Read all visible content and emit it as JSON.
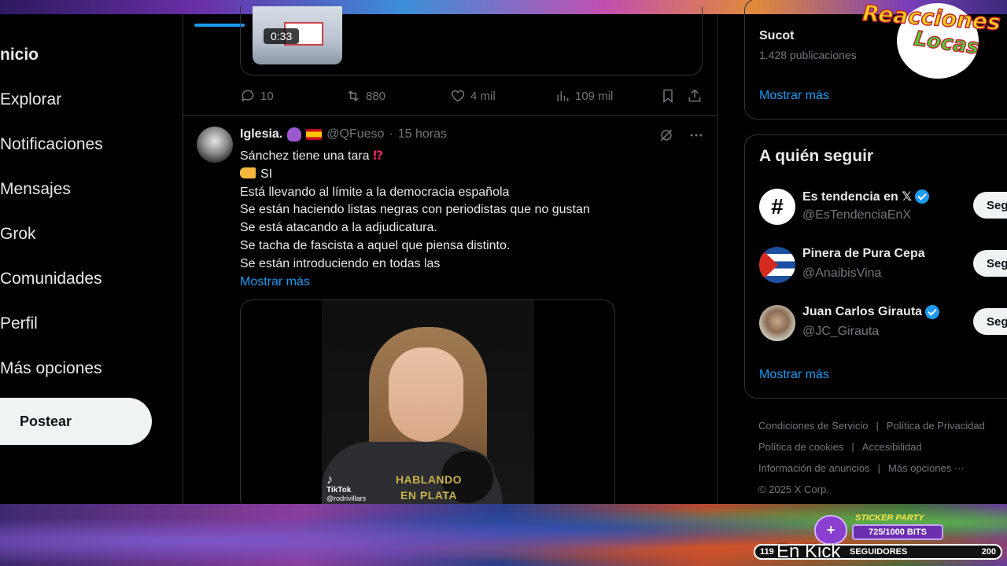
{
  "nav": {
    "items": [
      {
        "label": "nicio"
      },
      {
        "label": "Explorar"
      },
      {
        "label": "Notificaciones"
      },
      {
        "label": "Mensajes"
      },
      {
        "label": "Grok"
      },
      {
        "label": "Comunidades"
      },
      {
        "label": "Perfil"
      },
      {
        "label": "Más opciones"
      }
    ],
    "post_button": "Postear"
  },
  "previous_tweet": {
    "video_duration": "0:33",
    "actions": {
      "replies": "10",
      "reposts": "880",
      "likes": "4 mil",
      "views": "109 mil"
    }
  },
  "tweet": {
    "name": "Iglesia.",
    "handle": "@QFueso",
    "separator": "·",
    "time": "15 horas",
    "lines": [
      "Sánchez tiene una tara",
      "SI",
      "Está llevando al límite a la democracia española",
      "Se están haciendo listas negras con periodistas que no gustan",
      "Se está atacando a la adjudicatura.",
      "Se tacha de fascista a aquel que piensa distinto.",
      "Se están introduciendo en todas las"
    ],
    "interrobang": "⁉",
    "show_more": "Mostrar más",
    "video": {
      "watermark": "TikTok",
      "watermark_handle": "@rodrivillars",
      "caption": "HABLANDO EN PLATA"
    }
  },
  "sidebar": {
    "trend": {
      "name": "Sucot",
      "count": "1.428 publicaciones",
      "show_more": "Mostrar más"
    },
    "who_to_follow": {
      "title": "A quién seguir",
      "accounts": [
        {
          "name": "Es tendencia en 𝕏",
          "handle": "@EsTendenciaEnX",
          "verified": true,
          "button": "Seguir"
        },
        {
          "name": "Pinera de Pura Cepa",
          "handle": "@AnaibisVina",
          "verified": false,
          "button": "Seguir"
        },
        {
          "name": "Juan Carlos Girauta",
          "handle": "@JC_Girauta",
          "verified": true,
          "button": "Seguir"
        }
      ],
      "show_more": "Mostrar más"
    },
    "footer": {
      "terms": "Condiciones de Servicio",
      "privacy": "Política de Privacidad",
      "cookies": "Política de cookies",
      "accessibility": "Accesibilidad",
      "ads_info": "Información de anuncios",
      "more": "Más opciones ···",
      "copyright": "© 2025 X Corp.",
      "separator": "|"
    }
  },
  "overlay": {
    "logo_line1": "Reacciones",
    "logo_line2": "Locas",
    "sticker_title": "STICKER PARTY",
    "bits": "725/1000 BITS",
    "heart_symbol": "+",
    "followers_left": "119",
    "followers_label": "SEGUIDORES",
    "followers_right": "200",
    "platform": "En Kick"
  },
  "colors": {
    "accent": "#1d9bf0",
    "text": "#e7e9ea",
    "muted": "#71767b",
    "border": "#2f3336",
    "background": "#000000"
  }
}
